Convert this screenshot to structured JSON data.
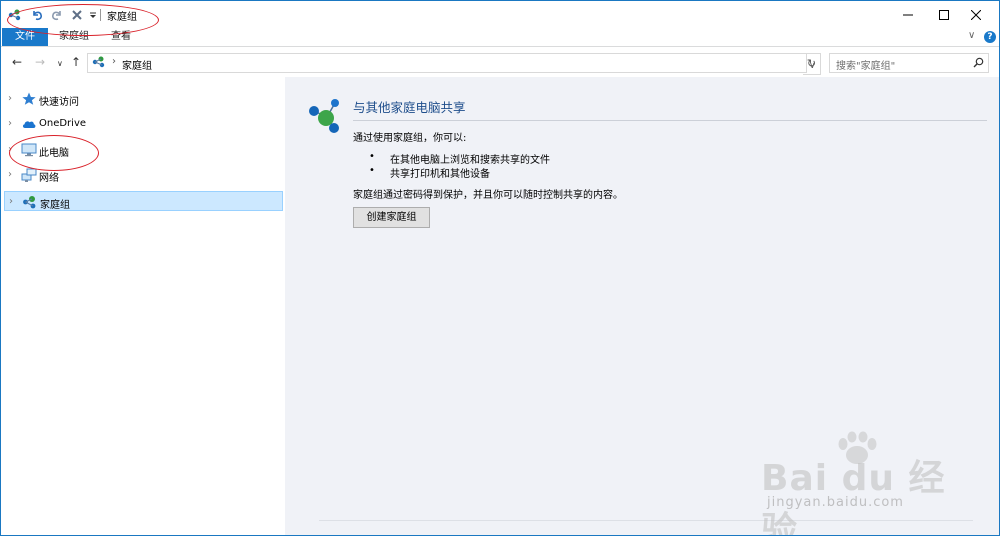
{
  "window": {
    "title": "家庭组",
    "controls": {
      "minimize": "—",
      "maximize": "☐",
      "close": "✕"
    }
  },
  "quick_access_toolbar": {
    "icons": [
      "homegroup-icon",
      "undo-icon",
      "redo-icon",
      "delete-icon",
      "customize-dropdown-icon"
    ]
  },
  "ribbon": {
    "tabs": [
      "文件",
      "家庭组",
      "查看"
    ],
    "expand_label": "∨",
    "help_label": "?"
  },
  "address_bar": {
    "back": "←",
    "forward": "→",
    "recent": "∨",
    "up": "↑",
    "chevron": "›",
    "path": "家庭组",
    "dropdown": "∨",
    "refresh": "↻"
  },
  "search": {
    "placeholder": "搜索\"家庭组\""
  },
  "nav_pane": {
    "items": [
      {
        "label": "快速访问",
        "icon": "star-icon",
        "expand": "›"
      },
      {
        "label": "OneDrive",
        "icon": "cloud-icon",
        "expand": "›"
      },
      {
        "label": "此电脑",
        "icon": "computer-icon",
        "expand": "›"
      },
      {
        "label": "网络",
        "icon": "network-icon",
        "expand": "›"
      },
      {
        "label": "家庭组",
        "icon": "homegroup-icon",
        "expand": "›",
        "selected": true
      }
    ]
  },
  "content": {
    "heading": "与其他家庭电脑共享",
    "intro": "通过使用家庭组，你可以:",
    "bullets": [
      "在其他电脑上浏览和搜索共享的文件",
      "共享打印机和其他设备"
    ],
    "bullet_mark": "•",
    "description": "家庭组通过密码得到保护，并且你可以随时控制共享的内容。",
    "create_button": "创建家庭组"
  },
  "watermark": {
    "text": "Bai du 经验",
    "url": "jingyan.baidu.com"
  },
  "colors": {
    "accent": "#1979ca",
    "selection": "#cce8ff",
    "heading": "#1e4e8c",
    "annotation": "#d9222a",
    "content_bg": "#f0f2f7"
  }
}
